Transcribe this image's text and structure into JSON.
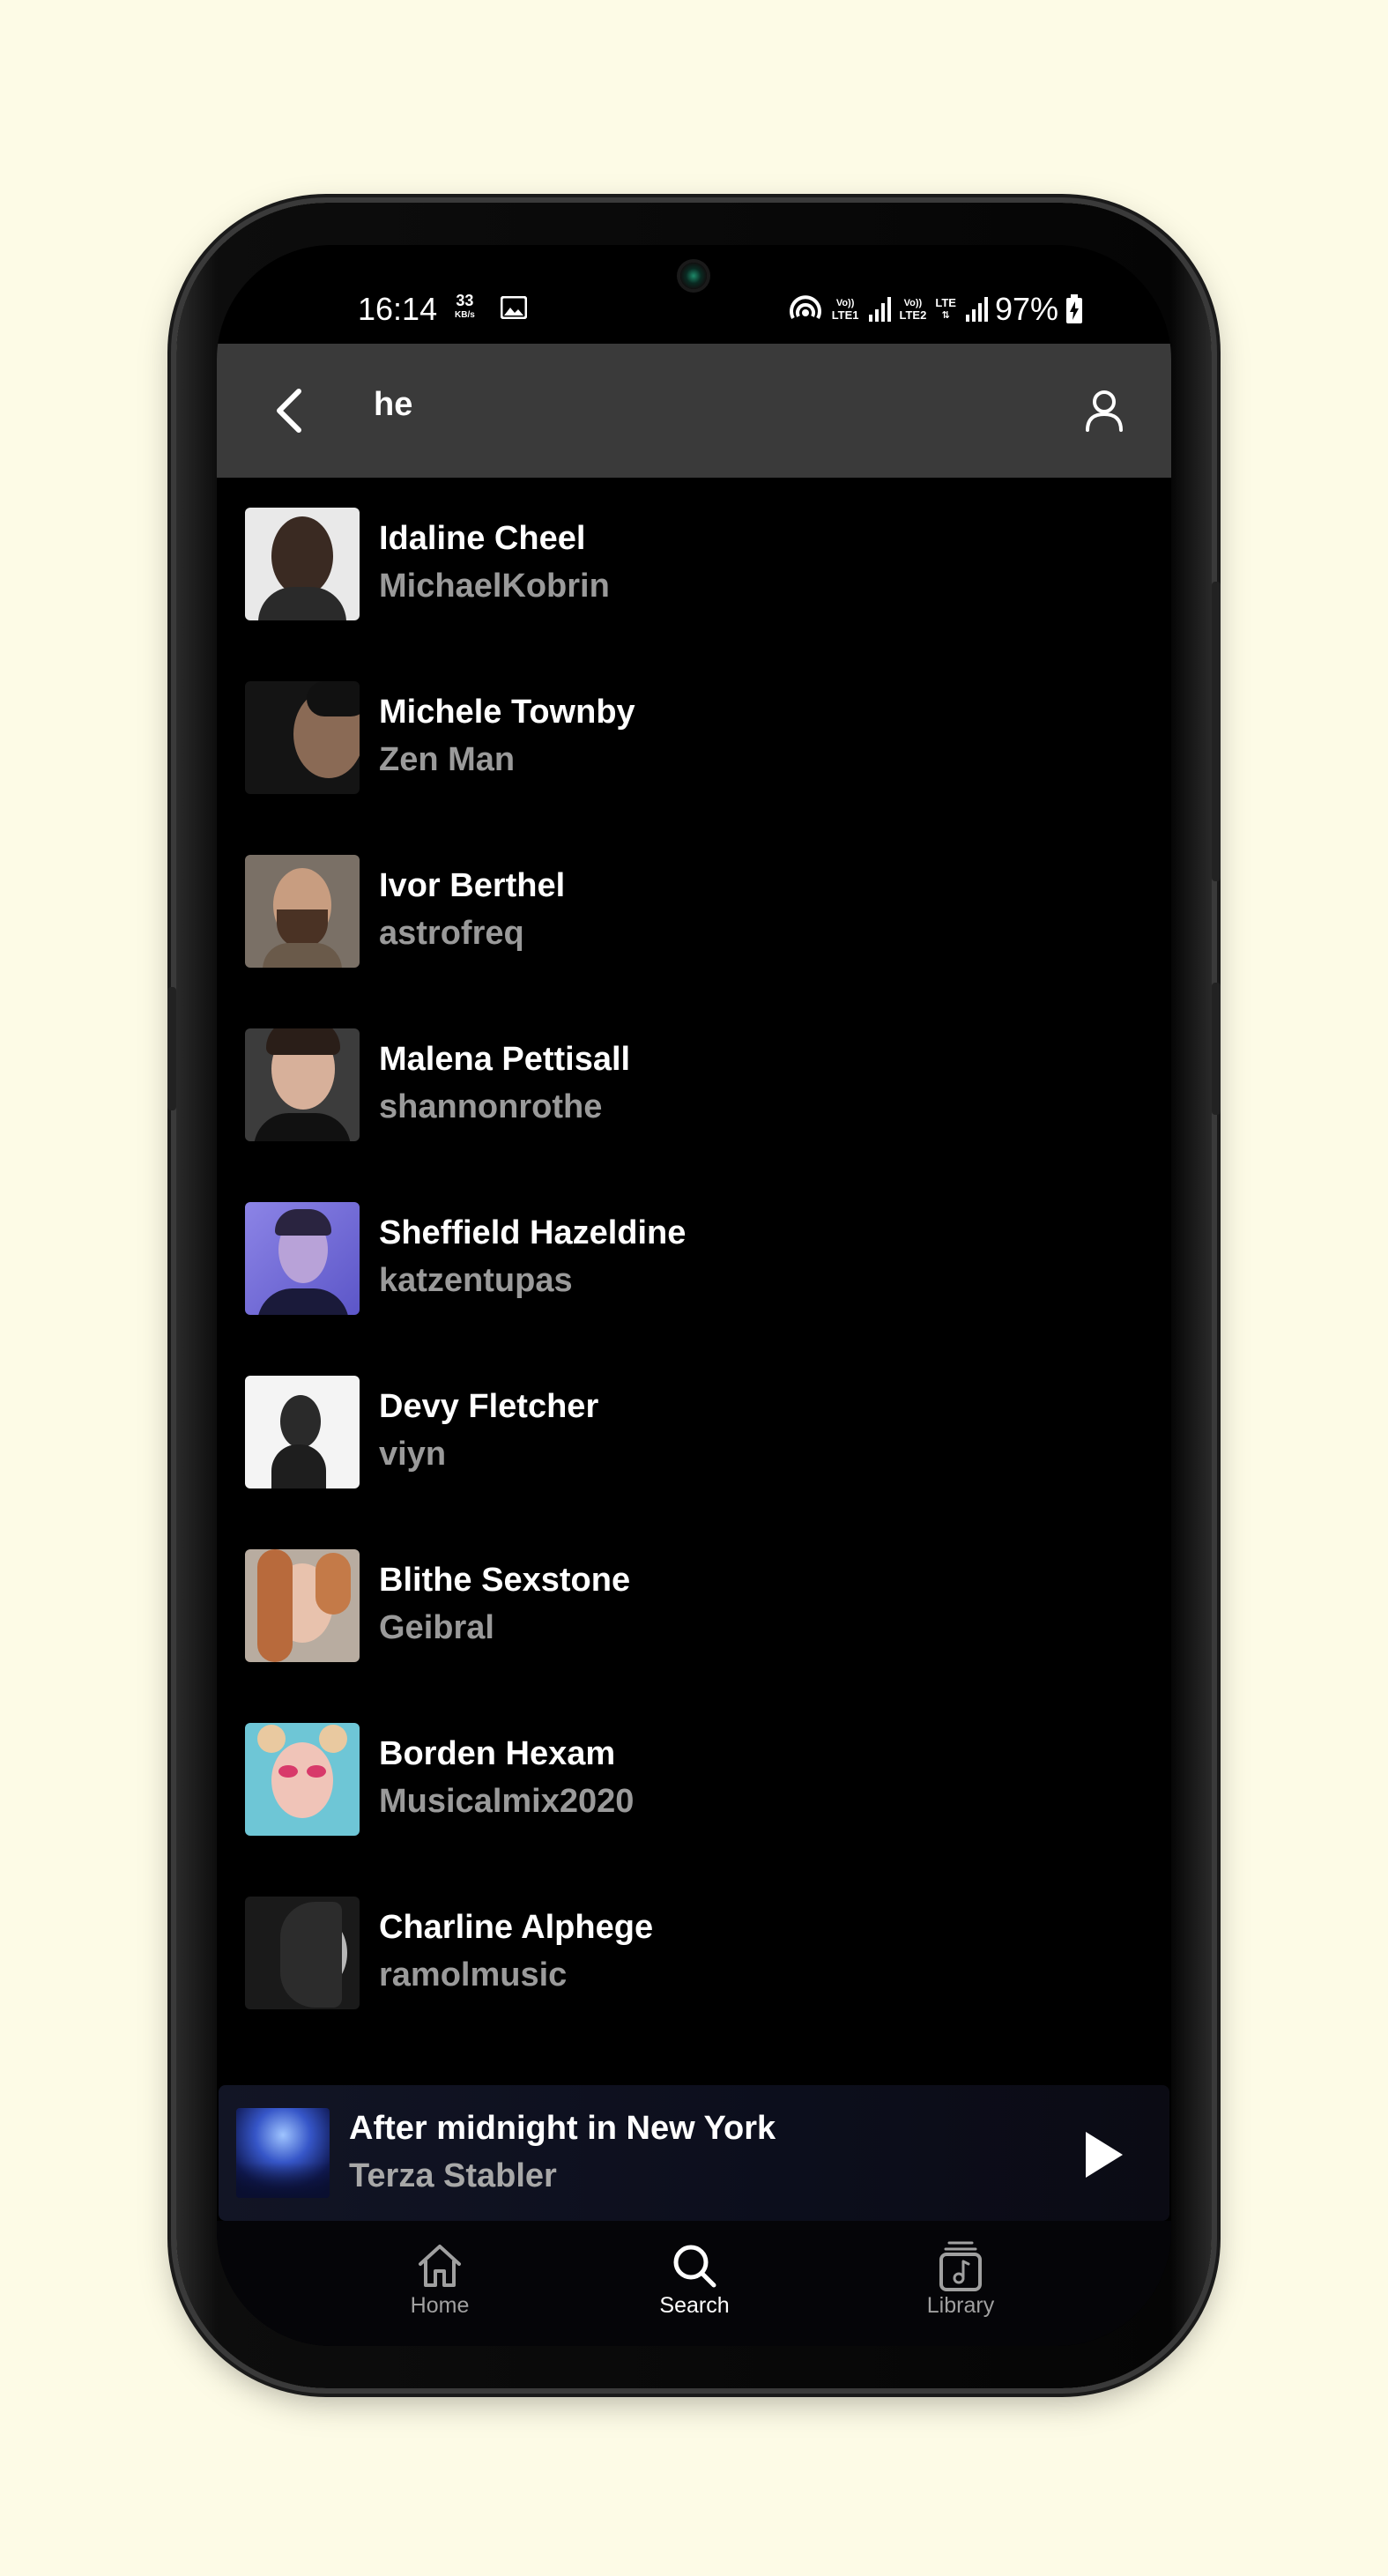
{
  "status_bar": {
    "time": "16:14",
    "net_speed_value": "33",
    "net_speed_unit": "KB/s",
    "sim1": "LTE1",
    "sim2": "LTE2",
    "lte": "LTE",
    "battery": "97%"
  },
  "search": {
    "query": "he"
  },
  "results": [
    {
      "title": "Idaline Cheel",
      "subtitle": "MichaelKobrin"
    },
    {
      "title": "Michele Townby",
      "subtitle": "Zen Man"
    },
    {
      "title": "Ivor Berthel",
      "subtitle": "astrofreq"
    },
    {
      "title": "Malena Pettisall",
      "subtitle": "shannonrothe"
    },
    {
      "title": "Sheffield Hazeldine",
      "subtitle": "katzentupas"
    },
    {
      "title": "Devy Fletcher",
      "subtitle": "viyn"
    },
    {
      "title": "Blithe Sexstone",
      "subtitle": "Geibral"
    },
    {
      "title": "Borden Hexam",
      "subtitle": "Musicalmix2020"
    },
    {
      "title": "Charline Alphege",
      "subtitle": "ramolmusic"
    }
  ],
  "now_playing": {
    "title": "After midnight in New York",
    "artist": "Terza Stabler"
  },
  "bottom_nav": [
    {
      "label": "Home",
      "icon": "home-icon",
      "active": false
    },
    {
      "label": "Search",
      "icon": "search-icon",
      "active": true
    },
    {
      "label": "Library",
      "icon": "library-icon",
      "active": false
    }
  ],
  "colors": {
    "background": "#fdfbe6",
    "top_bar": "#3a3a3a",
    "screen": "#000000",
    "subtitle_text": "#9a9a9a",
    "nav_active": "#ffffff",
    "nav_inactive": "#a0a0a0"
  }
}
